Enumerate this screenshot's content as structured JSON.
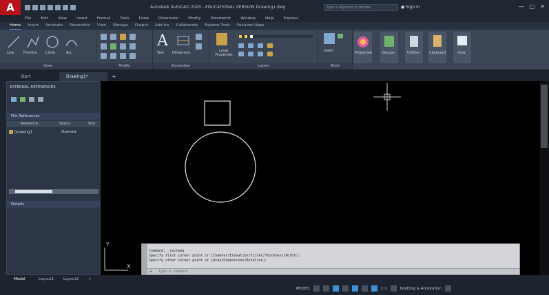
{
  "title_bar": {
    "app_logo": "A",
    "window_title": "Autodesk AutoCAD 2020 - EDUCATIONAL VERSION  Drawing1.dwg",
    "search_placeholder": "Type a keyword or phrase",
    "sign_in": "Sign In"
  },
  "menu": [
    "File",
    "Edit",
    "View",
    "Insert",
    "Format",
    "Tools",
    "Draw",
    "Dimension",
    "Modify",
    "Parametric",
    "Window",
    "Help",
    "Express"
  ],
  "ribbon_tabs": [
    "Home",
    "Insert",
    "Annotate",
    "Parametric",
    "View",
    "Manage",
    "Output",
    "Add-ins",
    "Collaborate",
    "Express Tools",
    "Featured Apps"
  ],
  "ribbon": {
    "draw_tools": [
      "Line",
      "Polyline",
      "Circle",
      "Arc"
    ],
    "panels": {
      "draw": "Draw",
      "modify": "Modify",
      "annotation": "Annotation",
      "layers": "Layers",
      "block": "Block"
    },
    "text_tool": "Text",
    "dimension_tool": "Dimension",
    "layer_properties": "Layer Properties",
    "insert_tool": "Insert",
    "big_tools": [
      "Properties",
      "Groups",
      "Utilities",
      "Clipboard",
      "View"
    ]
  },
  "file_tabs": [
    "Start",
    "Drawing1*"
  ],
  "xref_palette": {
    "title": "EXTERNAL REFERENCES",
    "file_references": "File References",
    "columns": [
      "Reference ...",
      "Status",
      "Size"
    ],
    "row": {
      "name": "Drawing1",
      "status": "Opened"
    },
    "details": "Details"
  },
  "command_line": {
    "lines": [
      "Command: _rectang",
      "Specify first corner point or [Chamfer/Elevation/Fillet/Thickness/Width]:",
      "Specify other corner point or [Area/Dimensions/Rotation]:"
    ],
    "placeholder": "Type a command"
  },
  "layout_tabs": [
    "Model",
    "Layout1",
    "Layout2"
  ],
  "status": {
    "model": "MODEL",
    "scale": "1:1",
    "workspace": "Drafting & Annotation"
  },
  "colors": {
    "app_red": "#b8121b",
    "accent_blue": "#3f8fd6",
    "canvas": "#000000",
    "ribbon": "#3b4556"
  }
}
